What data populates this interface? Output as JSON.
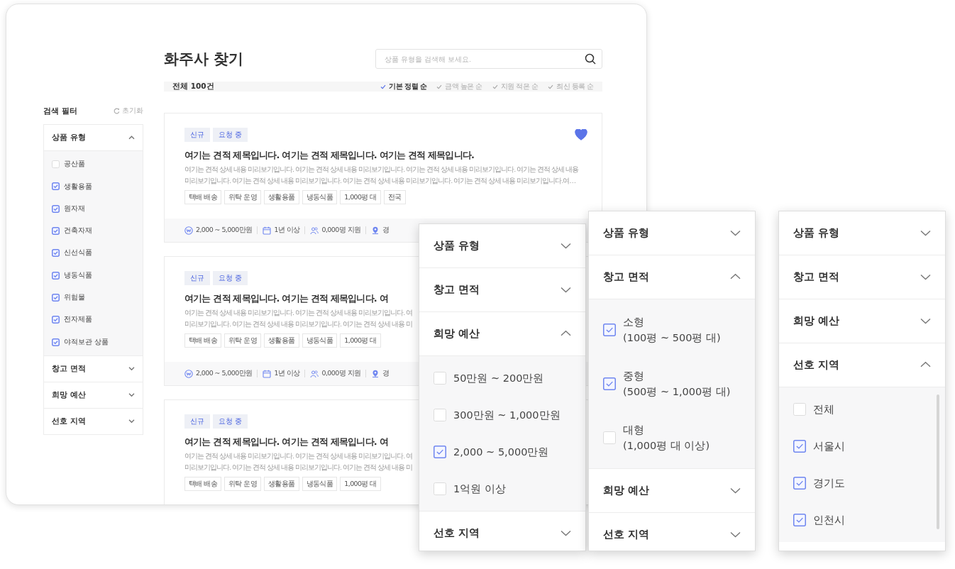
{
  "page": {
    "title": "화주사 찾기"
  },
  "search": {
    "placeholder": "상품 유형을 검색해 보세요."
  },
  "summary": {
    "count": "전체 100건",
    "sort_options": [
      {
        "label": "기본 정렬 순",
        "selected": true
      },
      {
        "label": "금액 높은 순",
        "selected": false
      },
      {
        "label": "지원 적은 순",
        "selected": false
      },
      {
        "label": "최신 등록 순",
        "selected": false
      }
    ]
  },
  "sidebar": {
    "title": "검색 필터",
    "reset": "초기화",
    "sections": [
      {
        "title": "상품 유형",
        "expanded": true,
        "options": [
          {
            "label": "공산품",
            "checked": false
          },
          {
            "label": "생활용품",
            "checked": true
          },
          {
            "label": "원자재",
            "checked": true
          },
          {
            "label": "건축자재",
            "checked": true
          },
          {
            "label": "신선식품",
            "checked": true
          },
          {
            "label": "냉동식품",
            "checked": true
          },
          {
            "label": "위험물",
            "checked": true
          },
          {
            "label": "전자제품",
            "checked": true
          },
          {
            "label": "야적보관 상품",
            "checked": true
          }
        ]
      },
      {
        "title": "창고 면적",
        "expanded": false
      },
      {
        "title": "희망 예산",
        "expanded": false
      },
      {
        "title": "선호 지역",
        "expanded": false
      }
    ]
  },
  "cards": [
    {
      "badges": [
        "신규",
        "요청 중"
      ],
      "liked": true,
      "title": "여기는 견적 제목입니다. 여기는 견적 제목입니다. 여기는 견적 제목입니다.",
      "description_lines": [
        "여기는 견적 상세 내용 미리보기입니다. 여기는 견적 상세 내용 미리보기입니다. 여기는 견적 상세 내용 미리보기입니다. 여기는 견적 상세 내용",
        "미리보기입니다. 여기는 견적 상세 내용 미리보기입니다. 여기는 견적 상세 내용 미리보기입니다. 여기는 견적 상세 내용 미리보기입니다.여…"
      ],
      "tags": [
        "택배 배송",
        "위탁 운영",
        "생활용품",
        "냉동식품",
        "1,000평 대",
        "전국"
      ],
      "meta": [
        {
          "kind": "budget",
          "text": "2,000 ~ 5,000만원"
        },
        {
          "kind": "period",
          "text": "1년 이상"
        },
        {
          "kind": "applicants",
          "text": "0,000명 지원"
        },
        {
          "kind": "region",
          "text": "경"
        }
      ]
    },
    {
      "badges": [
        "신규",
        "요청 중"
      ],
      "title": "여기는 견적 제목입니다. 여기는 견적 제목입니다. 여",
      "description_lines": [
        "여기는 견적 상세 내용 미리보기입니다. 여기는 견적 상세 내용 미리보기입니다. 여",
        "미리보기입니다. 여기는 견적 상세 내용 미리보기입니다. 여기는 견적 상세 내용 미"
      ],
      "tags": [
        "택배 배송",
        "위탁 운영",
        "생활용품",
        "냉동식품",
        "1,000평 대"
      ],
      "meta": [
        {
          "kind": "budget",
          "text": "2,000 ~ 5,000만원"
        },
        {
          "kind": "period",
          "text": "1년 이상"
        },
        {
          "kind": "applicants",
          "text": "0,000명 지원"
        },
        {
          "kind": "region",
          "text": "경"
        }
      ]
    },
    {
      "badges": [
        "신규",
        "요청 중"
      ],
      "title": "여기는 견적 제목입니다. 여기는 견적 제목입니다. 여",
      "description_lines": [
        "여기는 견적 상세 내용 미리보기입니다. 여기는 견적 상세 내용 미리보기입니다. 여",
        "미리보기입니다. 여기는 견적 상세 내용 미리보기입니다. 여기는 견적 상세 내용 미"
      ],
      "tags": [
        "택배 배송",
        "위탁 운영",
        "생활용품",
        "냉동식품",
        "1,000평 대"
      ]
    }
  ],
  "filter_panels": [
    {
      "scrollbar": false,
      "sections": [
        {
          "title": "상품 유형",
          "expanded": false
        },
        {
          "title": "창고 면적",
          "expanded": false
        },
        {
          "title": "희망 예산",
          "expanded": true,
          "options": [
            {
              "label": "50만원 ~ 200만원",
              "checked": false
            },
            {
              "label": "300만원 ~ 1,000만원",
              "checked": false
            },
            {
              "label": "2,000 ~ 5,000만원",
              "checked": true
            },
            {
              "label": "1억원 이상",
              "checked": false
            }
          ]
        },
        {
          "title": "선호 지역",
          "expanded": false
        }
      ]
    },
    {
      "scrollbar": false,
      "sections": [
        {
          "title": "상품 유형",
          "expanded": false
        },
        {
          "title": "창고 면적",
          "expanded": true,
          "options": [
            {
              "label": "소형\n(100평 ~ 500평 대)",
              "checked": true
            },
            {
              "label": "중형\n(500평 ~ 1,000평 대)",
              "checked": true
            },
            {
              "label": "대형\n(1,000평 대 이상)",
              "checked": false
            }
          ]
        },
        {
          "title": "희망 예산",
          "expanded": false
        },
        {
          "title": "선호 지역",
          "expanded": false
        }
      ]
    },
    {
      "scrollbar": true,
      "sections": [
        {
          "title": "상품 유형",
          "expanded": false
        },
        {
          "title": "창고 면적",
          "expanded": false
        },
        {
          "title": "희망 예산",
          "expanded": false
        },
        {
          "title": "선호 지역",
          "expanded": true,
          "options": [
            {
              "label": "전체",
              "checked": false
            },
            {
              "label": "서울시",
              "checked": true
            },
            {
              "label": "경기도",
              "checked": true
            },
            {
              "label": "인천시",
              "checked": true
            }
          ]
        }
      ]
    }
  ]
}
